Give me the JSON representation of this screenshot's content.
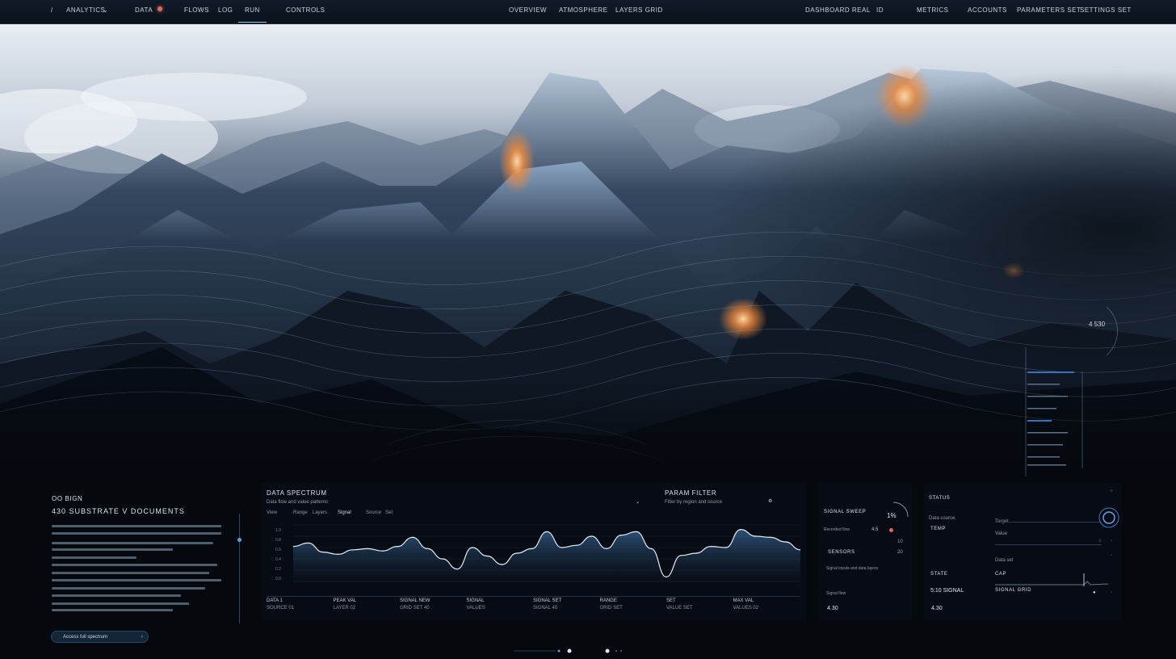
{
  "nav": {
    "left": [
      "ANALYTICS",
      "DATA",
      "FLOWS",
      "LOG",
      "RUN",
      "CONTROLS"
    ],
    "center": [
      "OVERVIEW",
      "ATMOSPHERE",
      "LAYERS GRID"
    ],
    "right": [
      "DASHBOARD REAL",
      "ID",
      "METRICS",
      "ACCOUNTS",
      "PARAMETERS SET",
      "SETTINGS SET"
    ]
  },
  "hud": {
    "readout": "4 530"
  },
  "intro": {
    "tag": "OO BIGN",
    "headline": "430 SUBSTRATE V DOCUMENTS",
    "button_label": "Access full spectrum"
  },
  "chart_panel": {
    "title": "DATA SPECTRUM",
    "subtitle": "Data flow and value patterns",
    "right_title": "PARAM FILTER",
    "right_sub": "Filter by region and source",
    "tabs": [
      "View",
      "Range",
      "Layers",
      "Signal",
      "Source",
      "Set"
    ],
    "footer": [
      {
        "label": "DATA 1",
        "value": "SOURCE 01"
      },
      {
        "label": "PEAK VAL",
        "value": "LAYER 02"
      },
      {
        "label": "SIGNAL NEW",
        "value": "GRID SET 40"
      },
      {
        "label": "SIGNAL",
        "value": "VALUES"
      },
      {
        "label": "SIGNAL SET",
        "value": "SIGNAL 40"
      },
      {
        "label": "RANGE",
        "value": "GRID SET"
      },
      {
        "label": "SET",
        "value": "VALUE SET"
      },
      {
        "label": "MAX VAL",
        "value": "VALUES 02"
      }
    ],
    "yticks": [
      "1.0",
      "0.8",
      "0.6",
      "0.4",
      "0.2",
      "0.0"
    ]
  },
  "chart_data": {
    "type": "area",
    "series": [
      {
        "values": [
          0.62,
          0.68,
          0.52,
          0.48,
          0.56,
          0.58,
          0.54,
          0.62,
          0.78,
          0.58,
          0.4,
          0.22,
          0.6,
          0.45,
          0.3,
          0.5,
          0.58,
          0.88,
          0.6,
          0.64,
          0.8,
          0.58,
          0.82,
          0.88,
          0.58,
          0.08,
          0.46,
          0.5,
          0.62,
          0.6,
          0.92,
          0.8,
          0.78,
          0.7,
          0.56
        ]
      }
    ],
    "ylim": [
      0,
      1
    ]
  },
  "metrics_panel": {
    "title": "SIGNAL SWEEP",
    "gauge": "1%",
    "row1": "Recorded flow",
    "row1_val": "4.5",
    "section": "SENSORS",
    "line1": "Signal inputs and data layers",
    "line2": "Signal flow",
    "bottom_val": "4.30",
    "row1_r": "10",
    "row2_r": "20"
  },
  "settings_panel": {
    "title": "STATUS",
    "items": [
      "Data source",
      "Target",
      "Value",
      "Data set"
    ],
    "labels": [
      "TEMP",
      "STATE",
      "CAP",
      "SIGNAL GRID"
    ],
    "values": [
      "5:10 SIGNAL",
      "4.30"
    ]
  }
}
